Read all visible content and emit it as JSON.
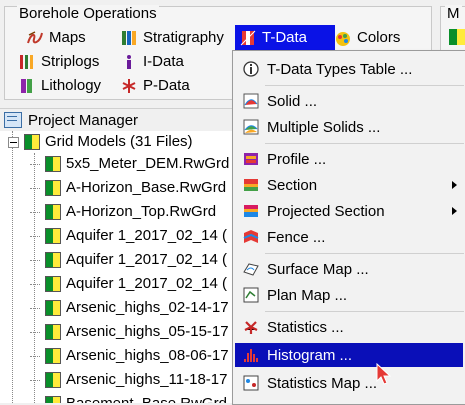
{
  "ribbon": {
    "group_title": "Borehole Operations",
    "group2_title": "M",
    "buttons": {
      "maps": "Maps",
      "stratigraphy": "Stratigraphy",
      "tdata": "T-Data",
      "colors": "Colors",
      "striplogs": "Striplogs",
      "idata": "I-Data",
      "lithology": "Lithology",
      "pdata": "P-Data"
    }
  },
  "project_manager": {
    "title": "Project Manager",
    "folder": "Grid Models (31 Files)",
    "files": [
      "5x5_Meter_DEM.RwGrd",
      "A-Horizon_Base.RwGrd",
      "A-Horizon_Top.RwGrd",
      "Aquifer 1_2017_02_14 (",
      "Aquifer 1_2017_02_14 (",
      "Aquifer 1_2017_02_14 (",
      "Arsenic_highs_02-14-17",
      "Arsenic_highs_05-15-17",
      "Arsenic_highs_08-06-17",
      "Arsenic_highs_11-18-17",
      "Basement_Base.RwGrd"
    ]
  },
  "menu": {
    "items": {
      "types_table": "T-Data Types Table ...",
      "solid": "Solid ...",
      "multiple_solids": "Multiple Solids ...",
      "profile": "Profile ...",
      "section": "Section",
      "projected_section": "Projected Section",
      "fence": "Fence ...",
      "surface_map": "Surface Map ...",
      "plan_map": "Plan Map ...",
      "statistics": "Statistics ...",
      "histogram": "Histogram ...",
      "statistics_map": "Statistics Map ..."
    },
    "highlighted": "histogram"
  },
  "colors": {
    "active_blue": "#0a12e6",
    "highlight_blue": "#0a0fb8"
  }
}
